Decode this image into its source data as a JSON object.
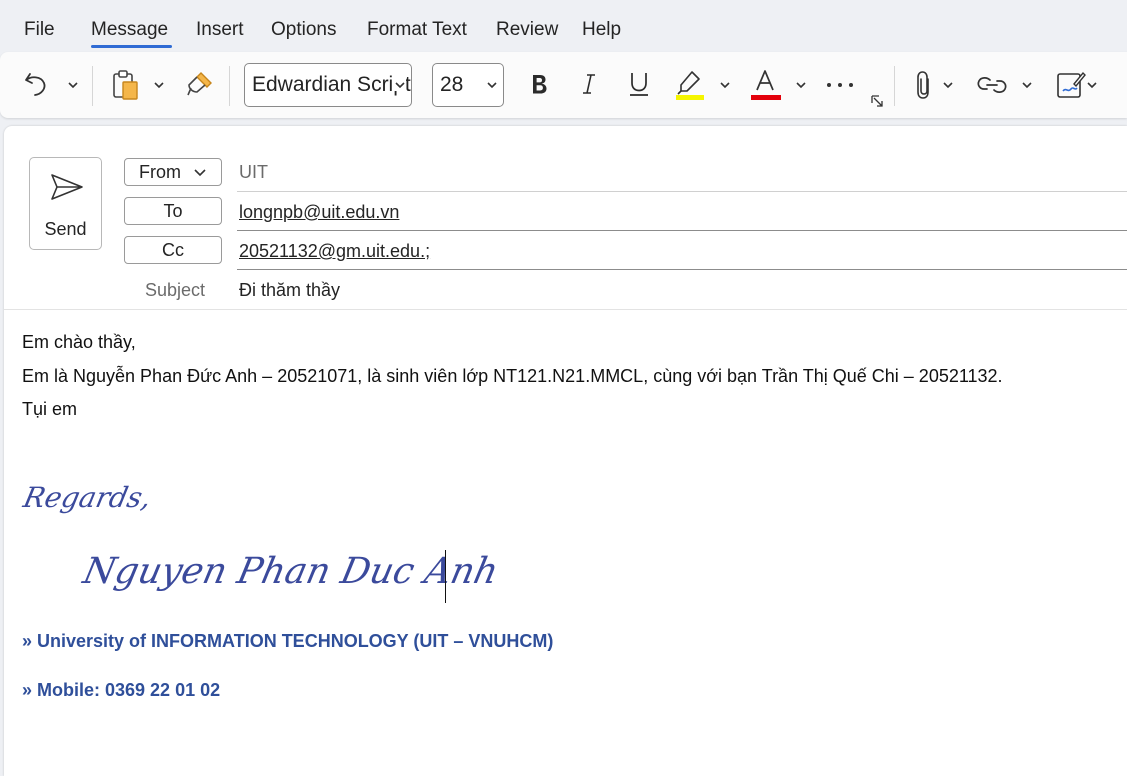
{
  "menu": {
    "tabs": [
      {
        "label": "File"
      },
      {
        "label": "Message",
        "active": true
      },
      {
        "label": "Insert"
      },
      {
        "label": "Options"
      },
      {
        "label": "Format Text"
      },
      {
        "label": "Review"
      },
      {
        "label": "Help"
      }
    ]
  },
  "ribbon": {
    "font_name": "Edwardian Script ITC",
    "font_size": "28",
    "icons": [
      "undo-icon",
      "paste-icon",
      "format-painter-icon",
      "bold-icon",
      "italic-icon",
      "underline-icon",
      "highlight-icon",
      "font-color-icon",
      "more-icon",
      "dialog-launcher-icon",
      "attach-file-icon",
      "link-icon",
      "signature-icon"
    ],
    "highlight_color": "#f5f500",
    "font_color": "#e3000b",
    "accent_color": "#2f6bd4"
  },
  "compose": {
    "send_label": "Send",
    "from_label": "From",
    "from_value": "UIT",
    "to_label": "To",
    "to_value": "longnpb@uit.edu.vn",
    "cc_label": "Cc",
    "cc_value": "20521132@gm.uit.edu.;",
    "subject_label": "Subject",
    "subject_value": "Đi thăm thầy"
  },
  "body": {
    "lines": [
      "Em chào thầy,",
      "Em là Nguyễn Phan Đức Anh – 20521071, là sinh viên lớp NT121.N21.MMCL, cùng với bạn Trần Thị Quế Chi – 20521132.",
      "Tụi em"
    ]
  },
  "signature": {
    "regards": "Regards,",
    "name": "Nguyen Phan Duc Anh",
    "university": "» University of INFORMATION TECHNOLOGY (UIT – VNUHCM)",
    "mobile": "» Mobile: 0369 22 01 02",
    "color": "#2f4f9a"
  }
}
